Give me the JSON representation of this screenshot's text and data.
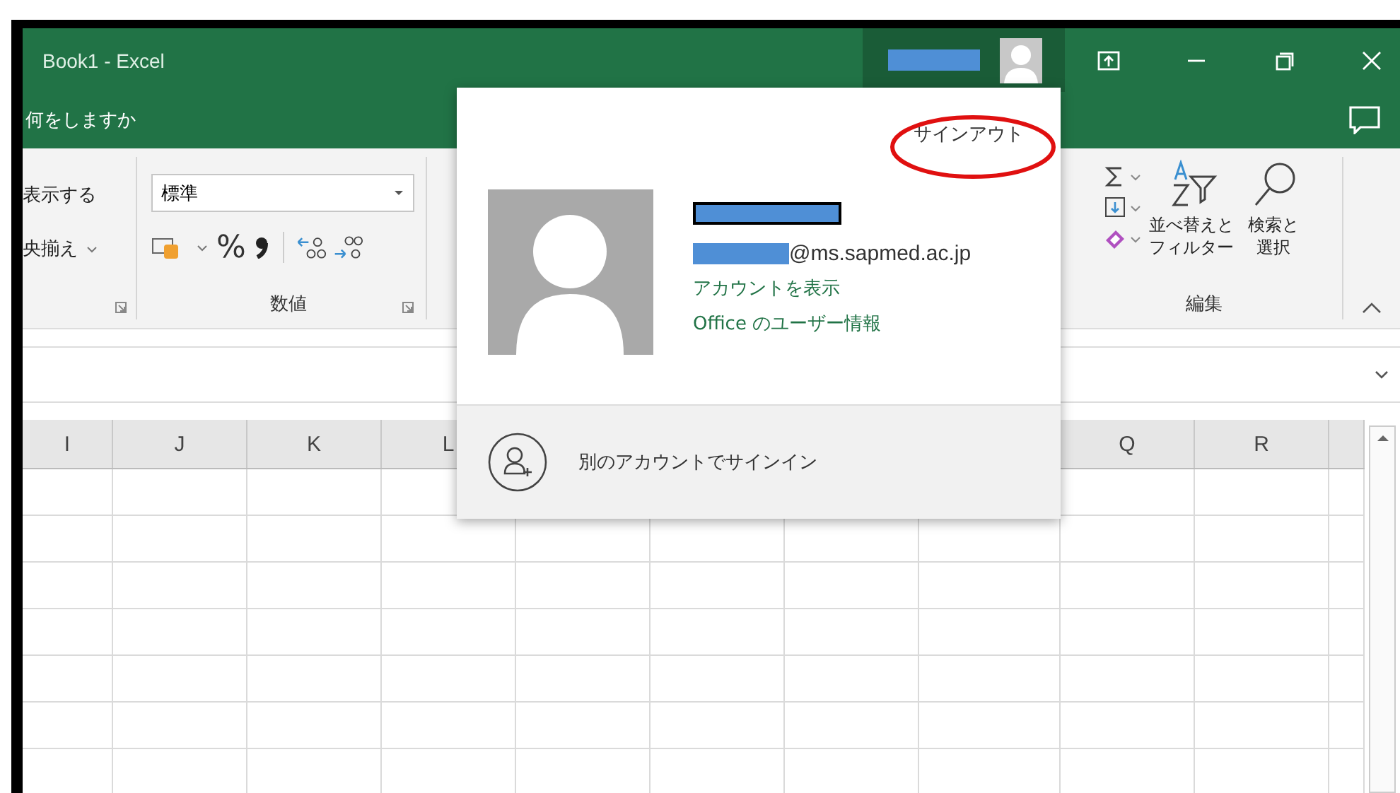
{
  "window": {
    "title": "Book1 - Excel",
    "tell_me": "何をしますか"
  },
  "ribbon": {
    "alignment": {
      "wrap_text": "表示する",
      "merge_center": "央揃え"
    },
    "number": {
      "format": "標準",
      "percent": "%",
      "label": "数値"
    },
    "editing": {
      "sort_filter": [
        "並べ替えと",
        "フィルター"
      ],
      "find_select": [
        "検索と",
        "選択"
      ],
      "label": "編集"
    }
  },
  "sheet": {
    "columns_before": [
      "I",
      "J",
      "K",
      "L"
    ],
    "columns_after": [
      "Q",
      "R"
    ]
  },
  "account_menu": {
    "sign_out": "サインアウト",
    "email": "@ms.sapmed.ac.jp",
    "links": [
      "アカウントを表示",
      "Office のユーザー情報"
    ],
    "switch_account": "別のアカウントでサインイン"
  }
}
